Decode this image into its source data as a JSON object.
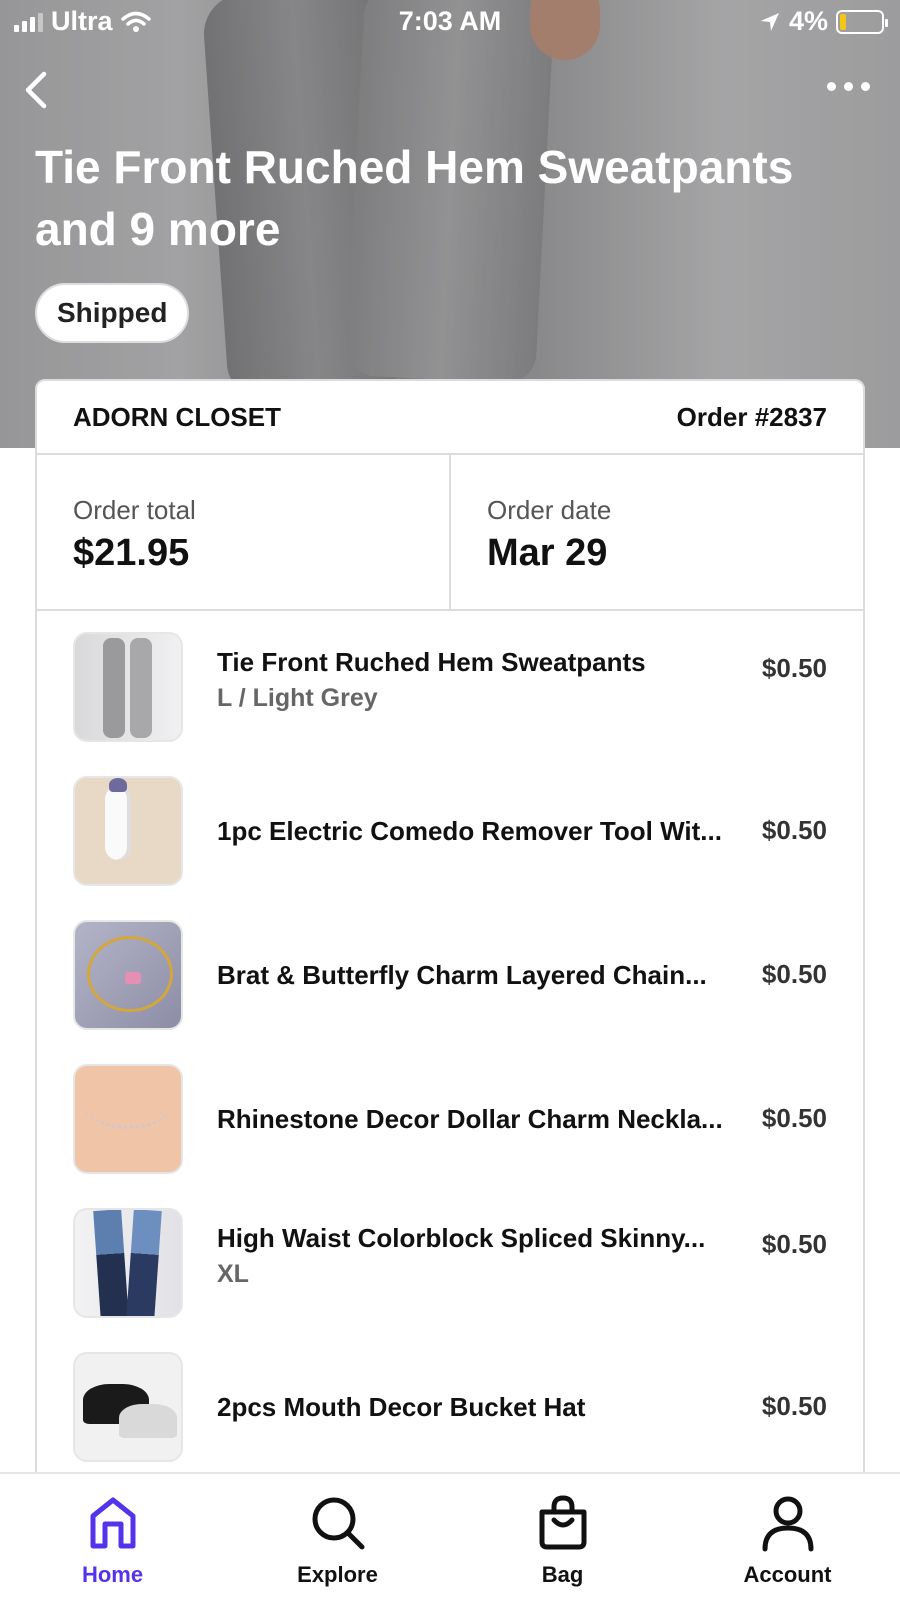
{
  "status_bar": {
    "carrier": "Ultra",
    "time": "7:03 AM",
    "battery": "4%"
  },
  "hero": {
    "title": "Tie Front Ruched Hem Sweatpants and 9 more",
    "status_badge": "Shipped"
  },
  "order": {
    "store": "ADORN CLOSET",
    "number": "Order #2837",
    "total_label": "Order total",
    "total_value": "$21.95",
    "date_label": "Order date",
    "date_value": "Mar 29"
  },
  "items": [
    {
      "name": "Tie Front Ruched Hem Sweatpants",
      "variant": "L / Light Grey",
      "price": "$0.50"
    },
    {
      "name": "1pc Electric Comedo Remover Tool Wit...",
      "variant": "",
      "price": "$0.50"
    },
    {
      "name": "Brat & Butterfly Charm Layered Chain...",
      "variant": "",
      "price": "$0.50"
    },
    {
      "name": "Rhinestone Decor Dollar Charm Neckla...",
      "variant": "",
      "price": "$0.50"
    },
    {
      "name": "High Waist Colorblock Spliced Skinny...",
      "variant": "XL",
      "price": "$0.50"
    },
    {
      "name": "2pcs Mouth Decor Bucket Hat",
      "variant": "",
      "price": "$0.50"
    }
  ],
  "tabs": [
    {
      "label": "Home",
      "icon": "home-icon",
      "active": true
    },
    {
      "label": "Explore",
      "icon": "search-icon",
      "active": false
    },
    {
      "label": "Bag",
      "icon": "bag-icon",
      "active": false
    },
    {
      "label": "Account",
      "icon": "account-icon",
      "active": false
    }
  ],
  "colors": {
    "accent": "#5433eb",
    "battery_low": "#f5c518"
  }
}
